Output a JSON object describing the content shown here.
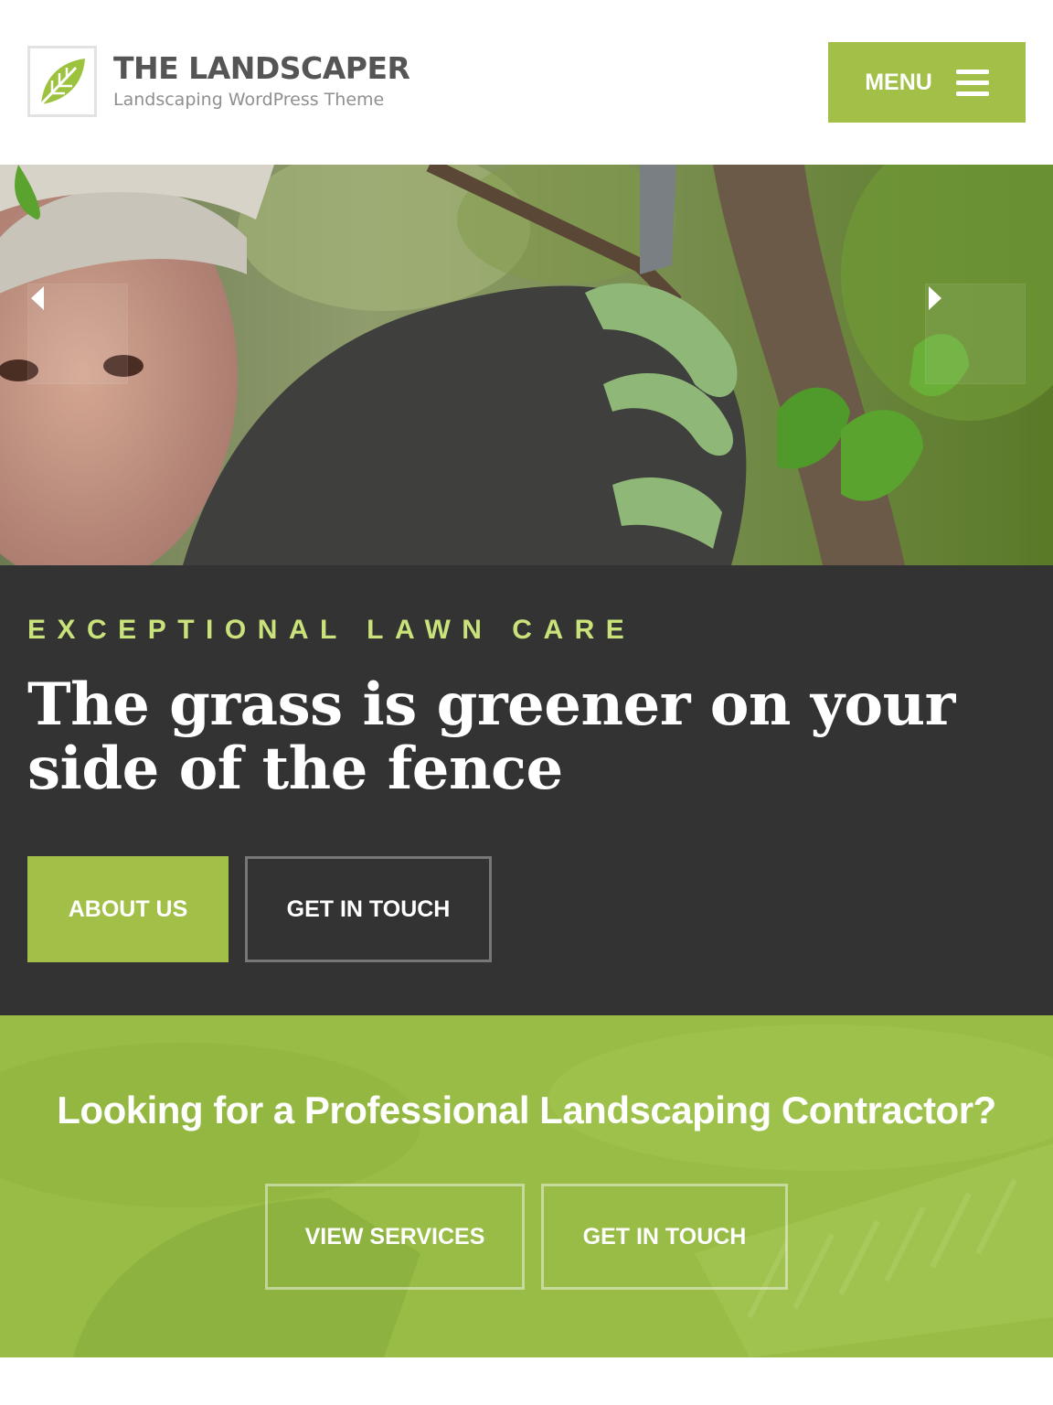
{
  "header": {
    "logo_title": "THE LANDSCAPER",
    "logo_tagline": "Landscaping WordPress Theme",
    "menu_label": "MENU"
  },
  "hero": {
    "prev_icon": "caret-left-icon",
    "next_icon": "caret-right-icon"
  },
  "caption": {
    "kicker": "EXCEPTIONAL LAWN CARE",
    "headline": "The grass is greener on your side of the fence",
    "primary_button": "ABOUT US",
    "secondary_button": "GET IN TOUCH"
  },
  "cta": {
    "title": "Looking for a Professional Landscaping Contractor?",
    "services_button": "VIEW SERVICES",
    "touch_button": "GET IN TOUCH"
  },
  "colors": {
    "accent": "#a2c047",
    "kicker": "#c9e27a",
    "dark_section": "#333333",
    "cta_section": "#98bc46",
    "logo_text": "#555555"
  }
}
